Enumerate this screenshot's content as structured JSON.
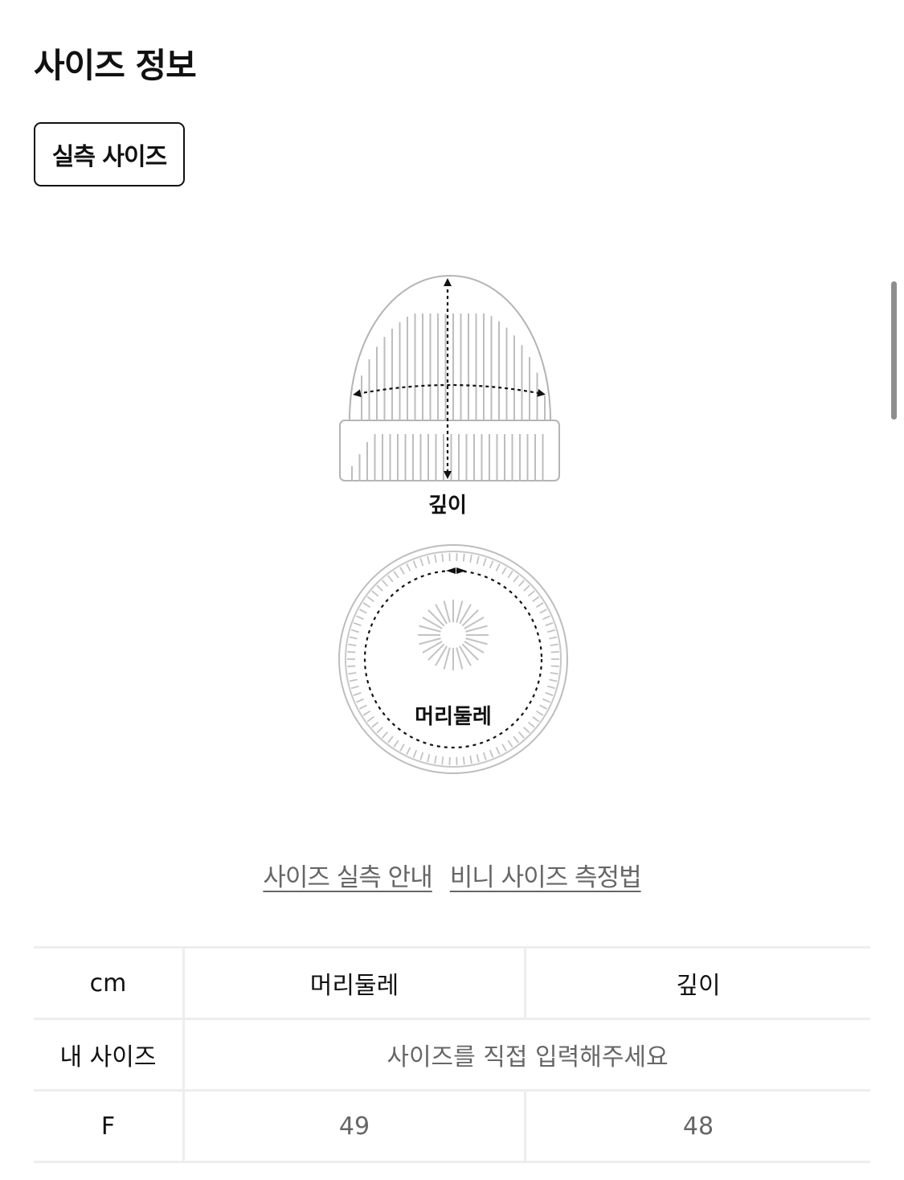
{
  "page": {
    "title": "사이즈 정보",
    "measure_tab_label": "실측 사이즈"
  },
  "diagram": {
    "depth_label": "깊이",
    "circumference_label": "머리둘레"
  },
  "links": {
    "size_guide": "사이즈 실측 안내",
    "beanie_measure": "비니 사이즈 측정법"
  },
  "table": {
    "unit": "cm",
    "columns": [
      "머리둘레",
      "깊이"
    ],
    "my_size_label": "내 사이즈",
    "my_size_placeholder": "사이즈를 직접 입력해주세요",
    "rows": [
      {
        "size": "F",
        "values": [
          "49",
          "48"
        ]
      }
    ]
  }
}
